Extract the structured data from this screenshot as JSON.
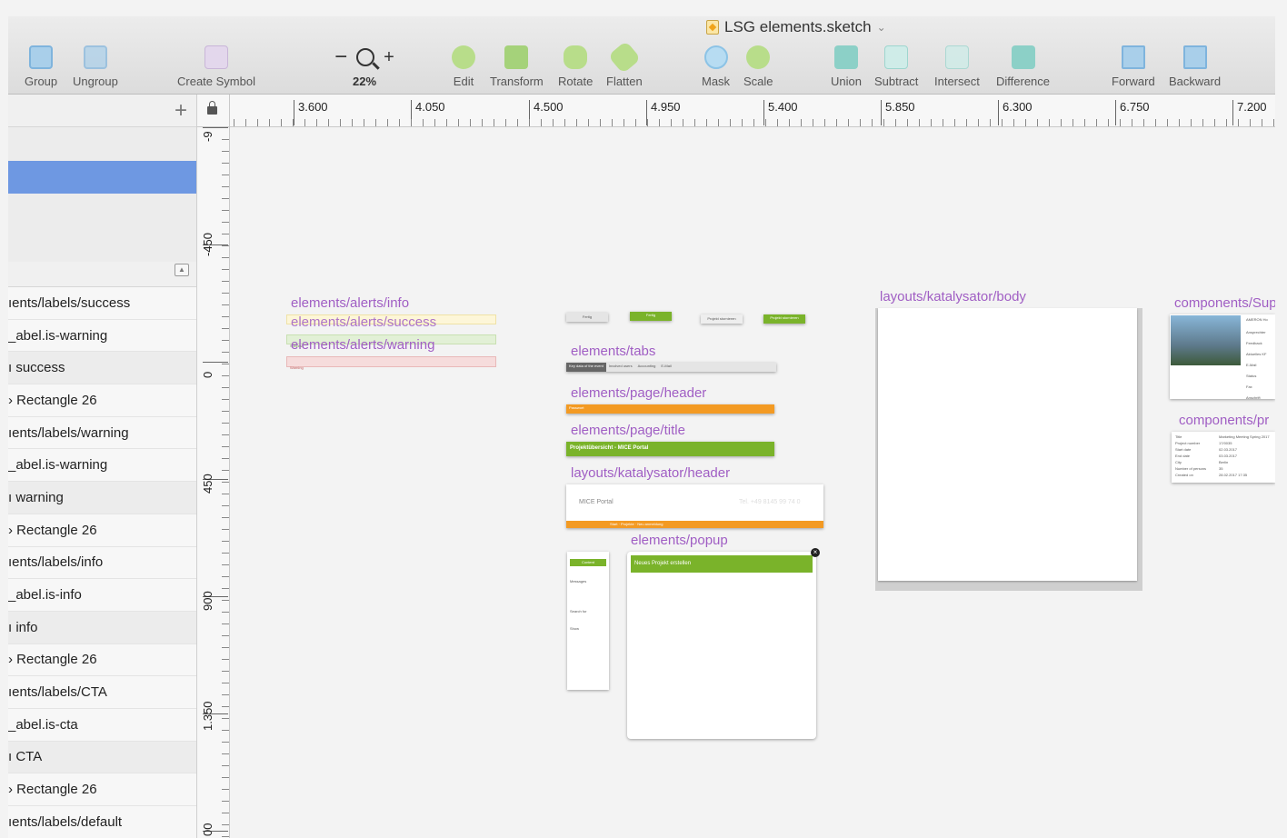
{
  "window": {
    "title": "LSG elements.sketch",
    "title_chevron": "⌄"
  },
  "toolbar": {
    "group": "Group",
    "ungroup": "Ungroup",
    "create_symbol": "Create Symbol",
    "zoom_minus": "−",
    "zoom_plus": "+",
    "zoom_level": "22%",
    "edit": "Edit",
    "transform": "Transform",
    "rotate": "Rotate",
    "flatten": "Flatten",
    "mask": "Mask",
    "scale": "Scale",
    "union": "Union",
    "subtract": "Subtract",
    "intersect": "Intersect",
    "difference": "Difference",
    "forward": "Forward",
    "backward": "Backward"
  },
  "sidebar": {
    "add_label": "+",
    "collapse_label": "▲",
    "layers": [
      "ıents/labels/success",
      "_abel.is-warning",
      "ı success",
      "› Rectangle 26",
      "ıents/labels/warning",
      "_abel.is-warning",
      "ı warning",
      "› Rectangle 26",
      "ıents/labels/info",
      "_abel.is-info",
      "ı info",
      "› Rectangle 26",
      "ıents/labels/CTA",
      "_abel.is-cta",
      "ı CTA",
      "› Rectangle 26",
      "ıents/labels/default"
    ]
  },
  "ruler_top": {
    "ticks": [
      "3.600",
      "4.050",
      "4.500",
      "4.950",
      "5.400",
      "5.850",
      "6.300",
      "6.750",
      "7.200"
    ]
  },
  "ruler_left": {
    "ticks": [
      "-9",
      "-450",
      "0",
      "450",
      "900",
      "1.350",
      "00"
    ]
  },
  "canvas": {
    "artboards": {
      "alerts_info": "elements/alerts/info",
      "alerts_success": "elements/alerts/success",
      "alerts_warning": "elements/alerts/warning",
      "tabs": "elements/tabs",
      "page_header": "elements/page/header",
      "page_title": "elements/page/title",
      "katalysator_header": "layouts/katalysator/header",
      "popup": "elements/popup",
      "katalysator_body": "layouts/katalysator/body",
      "components_sup": "components/Sup",
      "components_pr": "components/pr"
    },
    "mini": {
      "btn_fertig_1": "Fertig",
      "btn_fertig_2": "Fertig",
      "btn_projekt_1": "Projekt stornieren",
      "btn_projekt_2": "Projekt stornieren",
      "tab_1": "Key data of the event",
      "tab_2": "Involved users",
      "tab_3": "Accounting",
      "tab_4": "E-Mail",
      "header_text": "Passwort",
      "title_text": "Projektübersicht - MICE Portal",
      "mice_logo": "MICE Portal",
      "mice_phone": "Tel. +49 8145 99 74 0",
      "mice_bar": "Start · Projekte · Neu anmeldung",
      "popup_title": "Neues Projekt erstellen",
      "popup_close": "×",
      "side_top": "Content",
      "side_msg": "Messages",
      "side_search": "Search for",
      "side_show": "Show",
      "warning_small": "Warning",
      "success_small": "Success",
      "comp_header": "AMERON Ho",
      "comp_rows": [
        "Ansprechter",
        "Feedback",
        "Aktuelles KF",
        "E-Mail",
        "Status",
        "Fax",
        "Anschrift"
      ],
      "pr_rows": [
        "Title",
        "Project number",
        "Start date",
        "End date",
        "City",
        "Number of persons",
        "Created on"
      ],
      "pr_values": [
        "Marketing Meeting Spring 2017",
        "17/0035",
        "02.03.2017",
        "03.03.2017",
        "Berlin",
        "35",
        "28.02.2017 17:35"
      ]
    }
  }
}
